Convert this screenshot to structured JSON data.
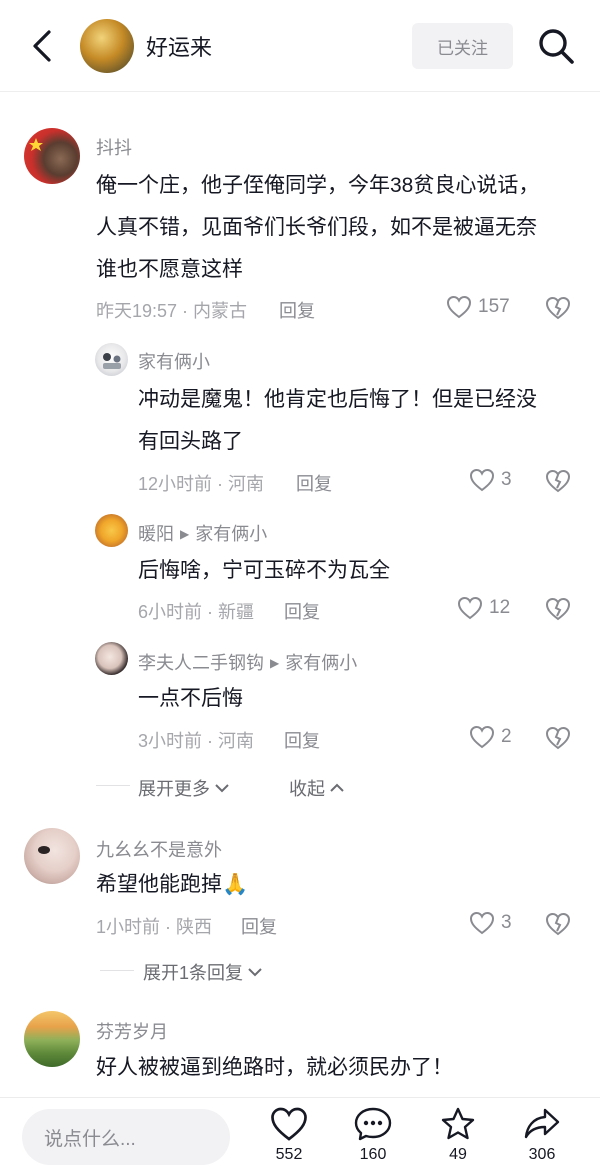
{
  "header": {
    "title": "好运来",
    "follow_label": "已关注"
  },
  "comments": [
    {
      "user": "抖抖",
      "text_lines": [
        "俺一个庄，他子侄俺同学，今年38贫良心说话，",
        "人真不错，见面爷们长爷们段，如不是被逼无奈",
        "谁也不愿意这样"
      ],
      "meta": "昨天19:57 · 内蒙古",
      "reply_label": "回复",
      "likes": "157",
      "replies": [
        {
          "user": "家有俩小",
          "reply_to": "",
          "text_lines": [
            "冲动是魔鬼！他肯定也后悔了！但是已经没",
            "有回头路了"
          ],
          "meta": "12小时前 · 河南",
          "reply_label": "回复",
          "likes": "3"
        },
        {
          "user": "暖阳",
          "reply_to": "家有俩小",
          "text_lines": [
            "后悔啥，宁可玉碎不为瓦全"
          ],
          "meta": "6小时前 · 新疆",
          "reply_label": "回复",
          "likes": "12"
        },
        {
          "user": "李夫人二手钢钩",
          "reply_to": "家有俩小",
          "text_lines": [
            "一点不后悔"
          ],
          "meta": "3小时前 · 河南",
          "reply_label": "回复",
          "likes": "2"
        }
      ],
      "expand_more": "展开更多",
      "collapse": "收起"
    },
    {
      "user": "九幺幺不是意外",
      "text_lines": [
        "希望他能跑掉🙏"
      ],
      "meta": "1小时前 · 陕西",
      "reply_label": "回复",
      "likes": "3",
      "expand_label": "展开1条回复"
    },
    {
      "user": "芬芳岁月",
      "text_lines": [
        "好人被被逼到绝路时，就必须民办了！"
      ]
    }
  ],
  "bottom_bar": {
    "input_placeholder": "说点什么...",
    "like_count": "552",
    "comment_count": "160",
    "favorite_count": "49",
    "share_count": "306"
  }
}
